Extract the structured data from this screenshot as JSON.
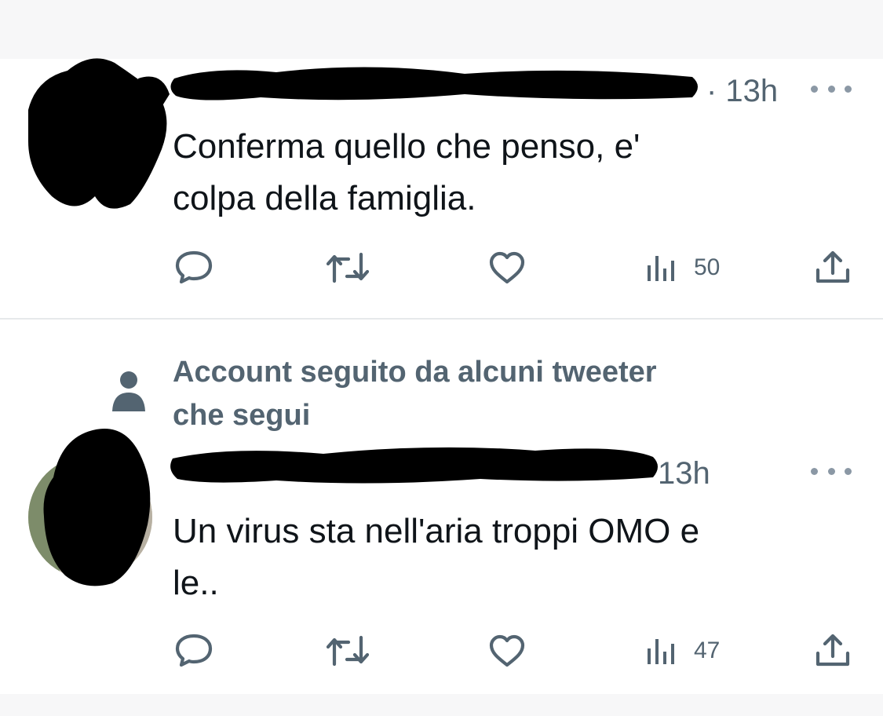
{
  "theme": {
    "text": "#0f1419",
    "secondary": "#536471",
    "divider": "#e6e9eb",
    "icon": "#536471"
  },
  "tweets": [
    {
      "time": "· 13h",
      "text": "Conferma quello che penso, e'\ncolpa della famiglia.",
      "views": "50",
      "icons": [
        "reply-icon",
        "retweet-icon",
        "like-icon",
        "views-icon",
        "share-icon"
      ]
    },
    {
      "social_context": "Account seguito da alcuni tweeter\nche segui",
      "time": "13h",
      "text": "Un virus sta nell'aria troppi OMO e\nle..",
      "views": "47",
      "icons": [
        "reply-icon",
        "retweet-icon",
        "like-icon",
        "views-icon",
        "share-icon"
      ]
    }
  ]
}
